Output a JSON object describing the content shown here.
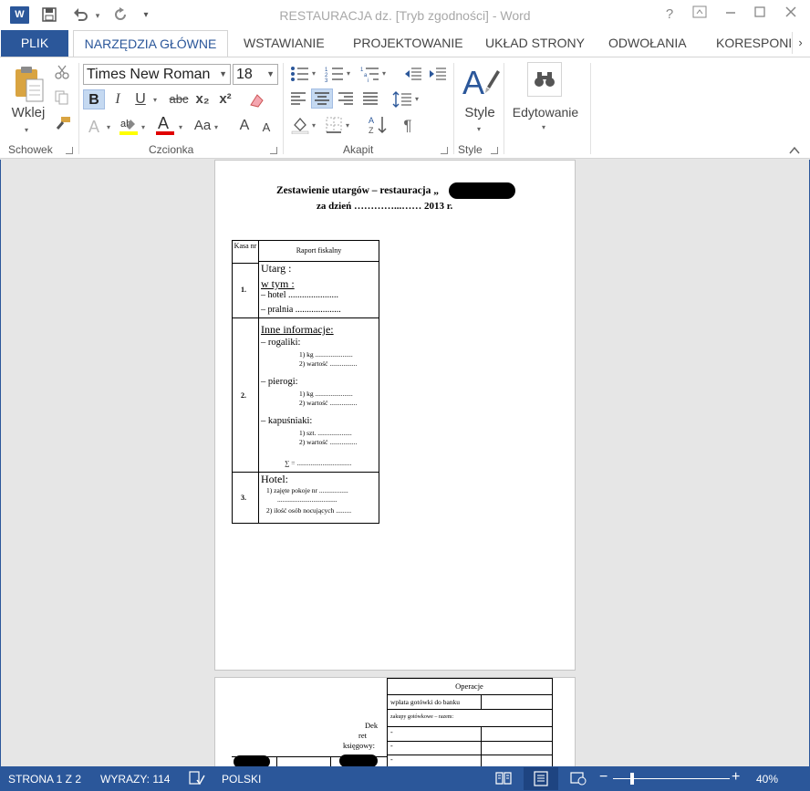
{
  "titlebar": {
    "app_logo": "W",
    "title": "RESTAURACJA dz. [Tryb zgodności] - Word",
    "help": "?",
    "icons": [
      "word-icon",
      "save-icon",
      "undo-icon",
      "redo-icon",
      "customize-qat-icon",
      "help-icon",
      "ribbon-display-icon",
      "minimize-icon",
      "maximize-icon",
      "close-icon"
    ]
  },
  "tabs": {
    "file": "PLIK",
    "items": [
      "NARZĘDZIA GŁÓWNE",
      "WSTAWIANIE",
      "PROJEKTOWANIE",
      "UKŁAD STRONY",
      "ODWOŁANIA",
      "KORESPOND"
    ],
    "active": "NARZĘDZIA GŁÓWNE"
  },
  "ribbon": {
    "clipboard": {
      "paste": "Wklej",
      "label": "Schowek"
    },
    "font": {
      "name": "Times New Roman",
      "size": "18",
      "bold": "B",
      "italic": "I",
      "underline": "U",
      "strike": "abc",
      "subscript": "x₂",
      "superscript": "x²",
      "grow": "A",
      "shrink": "A",
      "case": "Aa",
      "label": "Czcionka"
    },
    "paragraph": {
      "label": "Akapit",
      "pilcrow": "¶"
    },
    "styles": {
      "button": "Style",
      "label": "Style"
    },
    "editing": {
      "button": "Edytowanie"
    }
  },
  "document": {
    "page1": {
      "title": "Zestawienie utargów – restauracja „",
      "subtitle": "za dzień …………...…… 2013 r.",
      "table": {
        "col1_header": "Kasa nr",
        "col2_header": "Raport fiskalny",
        "row1": {
          "num": "1.",
          "utarg": "Utarg :",
          "wtym": "w tym :",
          "hotel": "–  hotel ......................",
          "pralnia": "–  pralnia ...................."
        },
        "row2": {
          "num": "2.",
          "inne": "Inne informacje:",
          "rogaliki": "–  rogaliki:",
          "rog_kg": "1)  kg ......................",
          "rog_wartosc": "2)  wartość ................",
          "pierogi": "–  pierogi:",
          "pie_kg": "1)  kg ......................",
          "pie_wartosc": "2)  wartość ................",
          "kapusniaki": "–  kapuśniaki:",
          "kap_szt": "1)  szt. ....................",
          "kap_wartosc": "2)  wartość ................",
          "sum": "∑ = ................................"
        },
        "row3": {
          "num": "3.",
          "hotel": "Hotel:",
          "pokoje": "1)  zajęte pokoje nr .................",
          "dots": "...................................",
          "osoby": "2)  ilość osób nocujących ........."
        }
      }
    },
    "page2": {
      "dek_line1": "Dek",
      "dek_line2": "ret",
      "dek_line3": "księgowy:",
      "operacje": "Operacje",
      "wplata": "wpłata gotówki do banku",
      "zakupy": "zakupy gotówkowe – razem:",
      "dash": "-"
    }
  },
  "statusbar": {
    "page": "STRONA 1 Z 2",
    "words": "WYRAZY: 114",
    "language": "POLSKI",
    "zoom_minus": "−",
    "zoom_plus": "+",
    "zoom": "40%",
    "zoom_level": 0.4
  },
  "colors": {
    "accent": "#2b579a",
    "bold_active": "#c5d9f1",
    "highlight": "#ffff00",
    "font_color": "#e00000"
  }
}
